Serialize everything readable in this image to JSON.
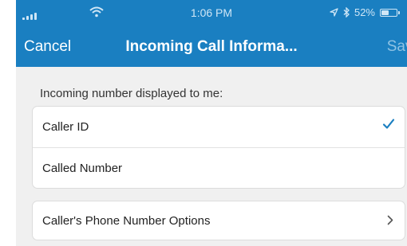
{
  "status_bar": {
    "time": "1:06 PM",
    "battery_text": "52%",
    "battery_level": 0.52
  },
  "nav": {
    "cancel": "Cancel",
    "title": "Incoming Call Informa...",
    "save": "Save"
  },
  "section": {
    "label": "Incoming number displayed to me:",
    "options": [
      {
        "label": "Caller ID",
        "selected": true
      },
      {
        "label": "Called Number",
        "selected": false
      }
    ]
  },
  "phone_options": {
    "label": "Caller's Phone Number Options"
  },
  "colors": {
    "nav_bar": "#1a7fc1",
    "check": "#1a7fc1",
    "background": "#f0f0f0"
  },
  "icons": [
    "signal-icon",
    "wifi-icon",
    "location-arrow-icon",
    "bluetooth-icon",
    "battery-icon",
    "checkmark-icon",
    "chevron-right-icon"
  ]
}
